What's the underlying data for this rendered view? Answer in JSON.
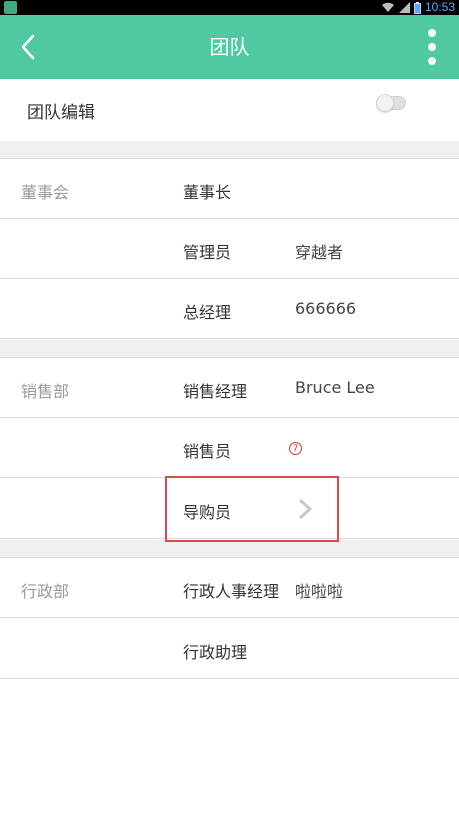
{
  "status_bar": {
    "time": "10:53"
  },
  "header": {
    "title": "团队"
  },
  "edit": {
    "label": "团队编辑",
    "toggle_on": false
  },
  "departments": [
    {
      "name": "董事会",
      "rows": [
        {
          "role": "董事长",
          "member": ""
        },
        {
          "role": "管理员",
          "member": "穿越者"
        },
        {
          "role": "总经理",
          "member": "666666"
        }
      ]
    },
    {
      "name": "销售部",
      "rows": [
        {
          "role": "销售经理",
          "member": "Bruce Lee"
        },
        {
          "role": "销售员",
          "badge": "7"
        },
        {
          "role": "导购员",
          "icon": "chevron-right-icon"
        }
      ]
    },
    {
      "name": "行政部",
      "rows": [
        {
          "role": "行政人事经理",
          "member": "啦啦啦"
        },
        {
          "role": "行政助理",
          "member": ""
        }
      ]
    }
  ],
  "colors": {
    "appbar": "#50c9a2",
    "highlight": "#d94a4a"
  }
}
